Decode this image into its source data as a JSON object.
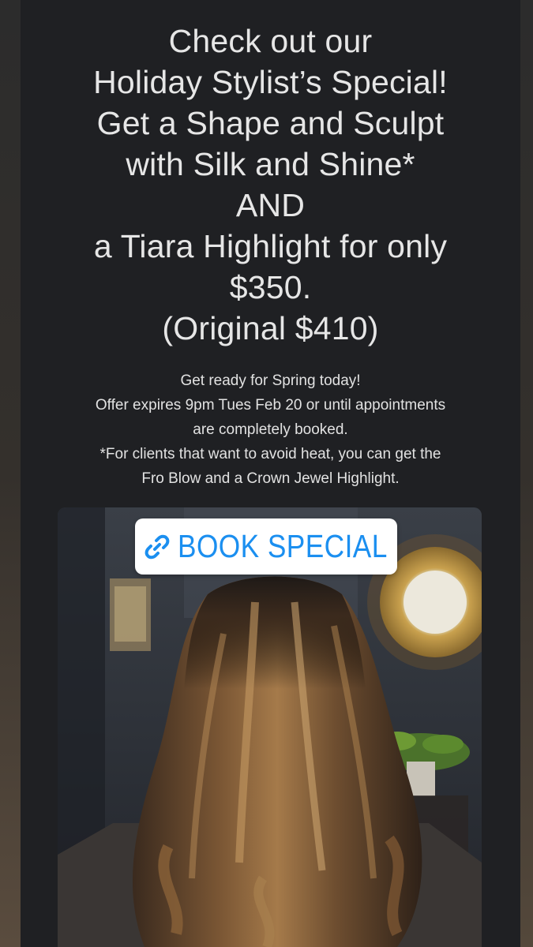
{
  "headline": {
    "lines": [
      "Check out our",
      "Holiday Stylist’s Special!",
      "Get a Shape and Sculpt",
      "with Silk and Shine*",
      "AND",
      "a Tiara Highlight for only",
      "$350.",
      "(Original $410)"
    ]
  },
  "details": {
    "lines": [
      "Get ready for Spring today!",
      "Offer expires 9pm Tues Feb 20 or until appointments",
      "are completely booked.",
      "*For clients that want to avoid heat, you can get the",
      "Fro Blow and a Crown Jewel Highlight."
    ]
  },
  "link_sticker": {
    "label": "BOOK SPECIAL",
    "icon": "link-icon",
    "color": "#1b8ff0"
  },
  "photo": {
    "subject": "hair-photo"
  },
  "colors": {
    "panel": "#1f2023",
    "text": "#e6e6e6",
    "accent": "#1b8ff0"
  }
}
